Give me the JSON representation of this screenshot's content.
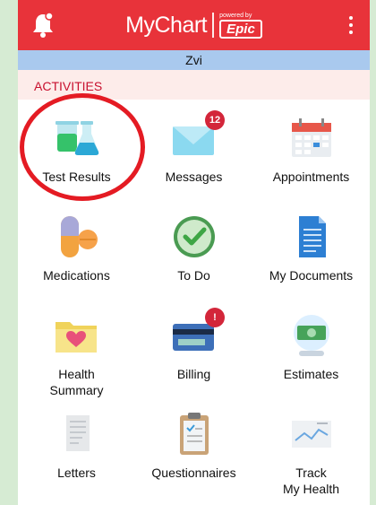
{
  "app": {
    "logo_text": "MyChart",
    "powered_by": "powered by",
    "epic_text": "Epic"
  },
  "user": {
    "name": "Zvi"
  },
  "section": {
    "title": "ACTIVITIES"
  },
  "tiles": [
    {
      "label": "Test Results",
      "icon": "test-tubes-icon"
    },
    {
      "label": "Messages",
      "icon": "envelope-icon",
      "badge": "12"
    },
    {
      "label": "Appointments",
      "icon": "calendar-icon"
    },
    {
      "label": "Medications",
      "icon": "pills-icon"
    },
    {
      "label": "To Do",
      "icon": "clock-check-icon"
    },
    {
      "label": "My Documents",
      "icon": "document-icon"
    },
    {
      "label": "Health\nSummary",
      "icon": "folder-heart-icon"
    },
    {
      "label": "Billing",
      "icon": "credit-card-icon",
      "badge": "!"
    },
    {
      "label": "Estimates",
      "icon": "money-globe-icon"
    },
    {
      "label": "Letters",
      "icon": "letter-icon"
    },
    {
      "label": "Questionnaires",
      "icon": "clipboard-icon"
    },
    {
      "label": "Track\nMy Health",
      "icon": "chart-tracker-icon"
    }
  ],
  "colors": {
    "brand_red": "#e8333a",
    "user_bar": "#a9c9ee",
    "section_bg": "#fdecea",
    "badge": "#d3263a",
    "highlight_circle": "#e41b23"
  }
}
